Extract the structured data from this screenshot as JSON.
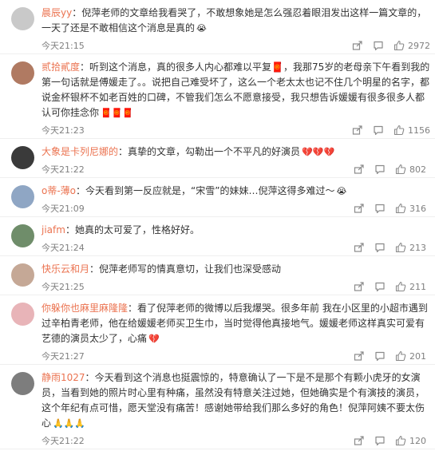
{
  "comments": [
    {
      "user": "晨辰yy",
      "sep": "：",
      "text": "倪萍老师的文章给我看哭了，不敢想象她是怎么强忍着眼泪发出这样一篇文章的，一天了还是不敢相信这个消息是真的",
      "emoji": "😭",
      "time": "今天21:15",
      "likes": "2972",
      "avatar_color": "#c9c9c9"
    },
    {
      "user": "贰拾貳度",
      "sep": "：",
      "text": "听到这个消息，真的很多人内心都难以平复🧧，我那75岁的老母亲下午看到我的第一句话就是傅媛走了。。说把自己难受坏了，这么一个老太太也记不住几个明星的名字，都说金杯银杯不如老百姓的口碑，不管我们怎么不愿意接受，我只想告诉媛媛有很多很多人都认可你挂念你",
      "emoji": "🧧🧧🧧",
      "time": "今天21:23",
      "likes": "1156",
      "avatar_color": "#b07a62"
    },
    {
      "user": "大象是卡列尼娜的",
      "sep": "：",
      "text": "真挚的文章，勾勒出一个不平凡的好演员",
      "emoji": "💔💔💔",
      "time": "今天21:22",
      "likes": "802",
      "avatar_color": "#3a3a3a"
    },
    {
      "user": "o蒂-薄o",
      "sep": "：",
      "text": "今天看到第一反应就是，“宋雪”的妹妹…倪萍这得多难过～",
      "emoji": "😭",
      "time": "今天21:09",
      "likes": "316",
      "avatar_color": "#8fa6c4"
    },
    {
      "user": "jiafm",
      "sep": "：",
      "text": "她真的太可爱了，性格好好。",
      "emoji": "",
      "time": "今天21:24",
      "likes": "213",
      "avatar_color": "#6f8d6a"
    },
    {
      "user": "快乐云和月",
      "sep": "：",
      "text": "倪萍老师写的情真意切，让我们也深受感动",
      "emoji": "",
      "time": "今天21:25",
      "likes": "211",
      "avatar_color": "#c5a896"
    },
    {
      "user": "你躲你也麻里麻隆隆",
      "sep": "：",
      "text": "看了倪萍老师的微博以后我爆哭。很多年前 我在小区里的小超市遇到过辛柏青老师，他在给媛媛老师买卫生巾，当时觉得他真接地气。媛媛老师这样真实可爱有艺德的演员太少了，心痛",
      "emoji": "💔",
      "time": "今天21:27",
      "likes": "201",
      "avatar_color": "#e8b4b8"
    },
    {
      "user": "静雨1027",
      "sep": "：",
      "text": "今天看到这个消息也挺震惊的，特意确认了一下是不是那个有颗小虎牙的女演员，当看到她的照片时心里有种痛，虽然没有特意关注过她，但她确实是个有演技的演员，这个年纪有点可惜，愿天堂没有痛苦！感谢她带给我们那么多好的角色！倪萍阿姨不要太伤心",
      "emoji": "🙏🙏🙏",
      "time": "今天21:22",
      "likes": "120",
      "avatar_color": "#7d7d7d"
    }
  ],
  "icons": {
    "share": "share-icon",
    "comment": "comment-icon",
    "like": "thumbs-up-icon"
  }
}
